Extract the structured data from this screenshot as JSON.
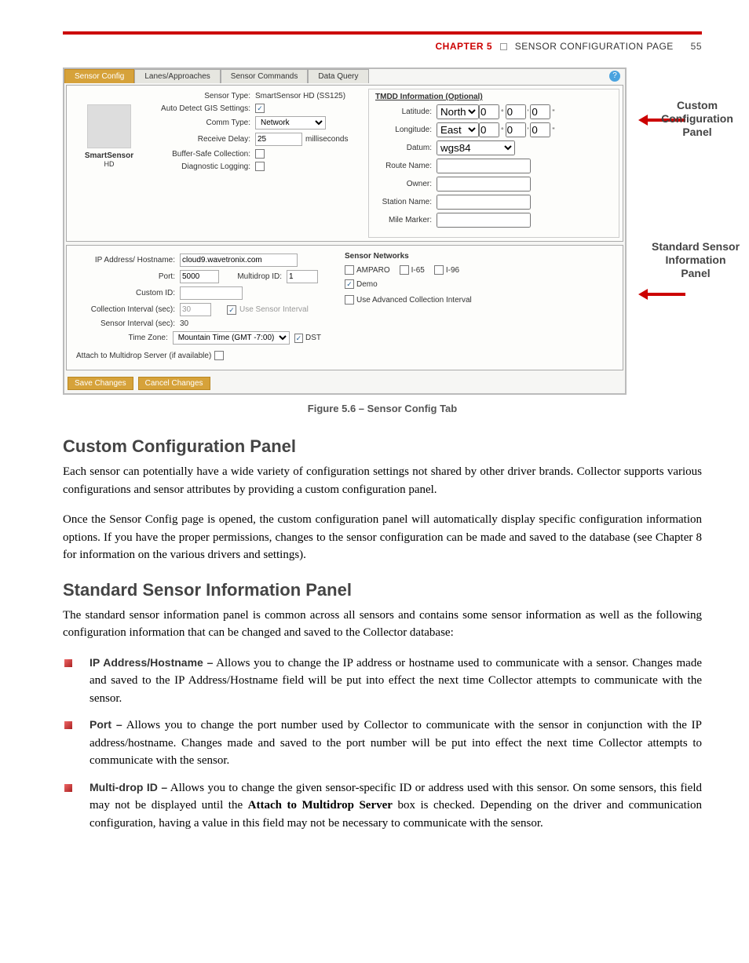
{
  "header": {
    "chapter_label": "CHAPTER 5",
    "title": "SENSOR CONFIGURATION PAGE",
    "page_number": "55"
  },
  "figure": {
    "tabs": {
      "sensor_config": "Sensor Config",
      "lanes": "Lanes/Approaches",
      "sensor_commands": "Sensor Commands",
      "data_query": "Data Query"
    },
    "help_icon": "?",
    "logo_title": "SmartSensor",
    "logo_sub": "HD",
    "fields": {
      "sensor_type_label": "Sensor Type:",
      "sensor_type_value": "SmartSensor HD (SS125)",
      "auto_detect_label": "Auto Detect GIS Settings:",
      "comm_type_label": "Comm Type:",
      "comm_type_value": "Network",
      "receive_delay_label": "Receive Delay:",
      "receive_delay_value": "25",
      "ms_label": "milliseconds",
      "buffer_safe_label": "Buffer-Safe Collection:",
      "diag_logging_label": "Diagnostic Logging:"
    },
    "tmdd": {
      "title": "TMDD Information (Optional)",
      "latitude_label": "Latitude:",
      "latitude_dir": "North",
      "lat_deg": "0",
      "lat_min": "0",
      "lat_sec": "0",
      "longitude_label": "Longitude:",
      "longitude_dir": "East",
      "lon_deg": "0",
      "lon_min": "0",
      "lon_sec": "0",
      "datum_label": "Datum:",
      "datum_value": "wgs84",
      "route_label": "Route Name:",
      "owner_label": "Owner:",
      "station_label": "Station Name:",
      "mile_label": "Mile Marker:"
    },
    "lower": {
      "ip_label": "IP Address/ Hostname:",
      "ip_value": "cloud9.wavetronix.com",
      "port_label": "Port:",
      "port_value": "5000",
      "multidrop_id_label": "Multidrop ID:",
      "multidrop_id_value": "1",
      "custom_id_label": "Custom ID:",
      "coll_interval_label": "Collection Interval (sec):",
      "coll_interval_value": "30",
      "use_sensor_interval_label": "Use Sensor Interval",
      "sensor_interval_label": "Sensor Interval (sec):",
      "sensor_interval_value": "30",
      "time_zone_label": "Time Zone:",
      "time_zone_value": "Mountain Time (GMT -7:00)",
      "dst_label": "DST",
      "attach_label": "Attach to Multidrop Server (if available)"
    },
    "sensor_networks": {
      "title": "Sensor Networks",
      "amparo": "AMPARO",
      "i65": "I-65",
      "i96": "I-96",
      "demo": "Demo",
      "use_adv": "Use Advanced Collection Interval"
    },
    "buttons": {
      "save": "Save Changes",
      "cancel": "Cancel Changes"
    },
    "callouts": {
      "custom_panel_1": "Custom",
      "custom_panel_2": "Configuration",
      "custom_panel_3": "Panel",
      "std_panel_1": "Standard Sensor",
      "std_panel_2": "Information",
      "std_panel_3": "Panel"
    },
    "caption": "Figure 5.6 – Sensor Config Tab"
  },
  "sections": {
    "custom_config_heading": "Custom Configuration Panel",
    "custom_config_p1": "Each sensor can potentially have a wide variety of configuration settings not shared by other driver brands. Collector supports various configurations and sensor attributes by providing a custom configuration panel.",
    "custom_config_p2": "Once the Sensor Config page is opened, the custom configuration panel will automatically display specific configuration information options. If you have the proper permissions, changes to the sensor configuration can be made and saved to the database (see Chapter 8 for information on the various drivers and settings).",
    "std_info_heading": "Standard Sensor Information Panel",
    "std_info_p1": "The standard sensor information panel is common across all sensors and contains some sensor information as well as the following configuration information that can be changed and saved to the Collector database:",
    "bullets": {
      "ip_term": "IP Address/Hostname –",
      "ip_text": " Allows you to change the IP address or hostname used to communicate with a sensor. Changes made and saved to the IP Address/Hostname field will be put into effect the next time Collector attempts to communicate with the sensor.",
      "port_term": "Port –",
      "port_text": " Allows you to change the port number used by Collector to communicate with the sensor in conjunction with the IP address/hostname. Changes made and saved to the port number will be put into effect the next time Collector attempts to communicate with the sensor.",
      "multi_term": "Multi-drop ID –",
      "multi_text_a": " Allows you to change the given sensor-specific ID or address used with this sensor. On some sensors, this field may not be displayed until the ",
      "multi_text_bold": "Attach to Multidrop Server",
      "multi_text_b": " box is checked. Depending on the driver and communication configuration, having a value in this field may not be necessary to communicate with the sensor."
    }
  }
}
